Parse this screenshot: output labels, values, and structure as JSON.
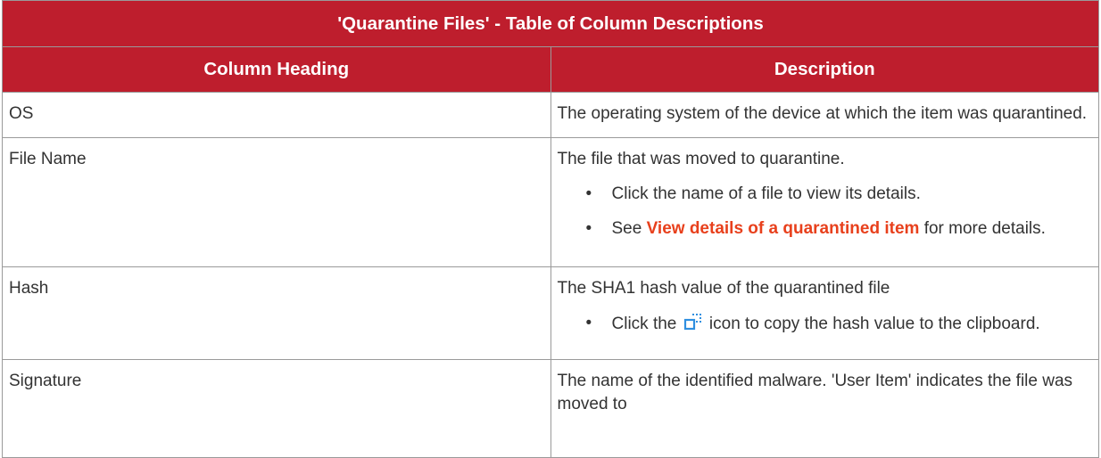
{
  "table": {
    "title": "'Quarantine Files' - Table of Column Descriptions",
    "headers": {
      "column_heading": "Column Heading",
      "description": "Description"
    },
    "rows": {
      "os": {
        "heading": "OS",
        "description": "The operating system of the device at which the item was quarantined."
      },
      "file_name": {
        "heading": "File Name",
        "description": "The file that was moved to quarantine.",
        "bullet_1": "Click the name of a file to view its details.",
        "bullet_2_prefix": "See ",
        "bullet_2_link": "View details of a quarantined item",
        "bullet_2_suffix": " for more details."
      },
      "hash": {
        "heading": "Hash",
        "description": "The SHA1 hash value of the quarantined file",
        "bullet_1_prefix": "Click the ",
        "bullet_1_icon": "copy-icon",
        "bullet_1_suffix": " icon to copy the hash value to the clipboard."
      },
      "signature": {
        "heading": "Signature",
        "description": "The name of the identified malware. 'User Item' indicates the file was moved to"
      }
    }
  },
  "bullet_glyph": "•",
  "colors": {
    "header_bg": "#be1e2d",
    "header_text": "#ffffff",
    "link": "#e8401c",
    "border": "#9a9a9a",
    "body_text": "#333333",
    "icon_blue": "#2f8fe0"
  }
}
